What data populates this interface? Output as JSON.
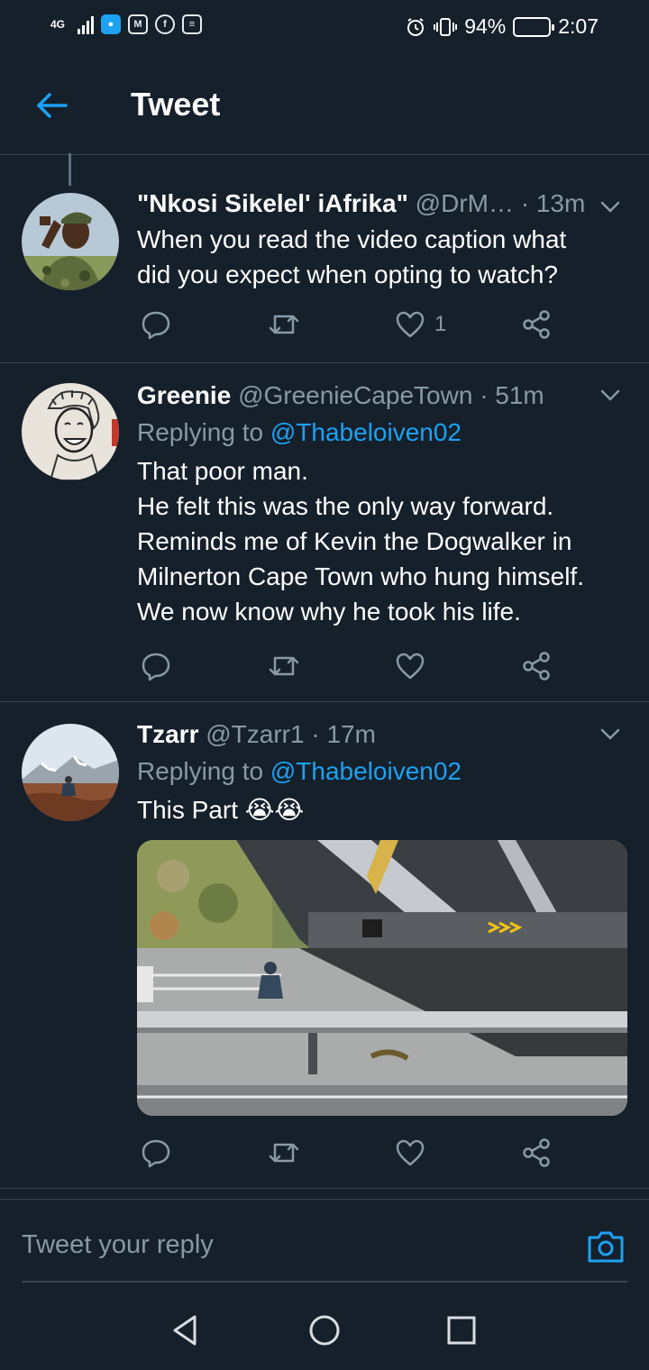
{
  "status_bar": {
    "network": "4G",
    "battery": "94%",
    "battery_level": 0.94,
    "time": "2:07",
    "app_icons": [
      "shield-app-icon",
      "gmail-icon",
      "facebook-icon",
      "news-icon"
    ]
  },
  "header": {
    "title": "Tweet"
  },
  "tweets": [
    {
      "name": "\"Nkosi Sikelel' iAfrika\"",
      "handle": "@DrM…",
      "time": "· 13m",
      "replying_label": "",
      "replying_to": "",
      "lines": [
        "When you read the video caption what",
        "did you expect when opting to watch?"
      ],
      "like_count": "1"
    },
    {
      "name": "Greenie",
      "handle": "@GreenieCapeTown",
      "time": "· 51m",
      "replying_label": "Replying to",
      "replying_to": "@Thabeloiven02",
      "lines": [
        "That poor man.",
        "He felt this was the only way forward.",
        "Reminds me of Kevin the Dogwalker in",
        "Milnerton Cape Town who hung himself.",
        "We now know why he took his life."
      ],
      "like_count": ""
    },
    {
      "name": "Tzarr",
      "handle": "@Tzarr1",
      "time": "· 17m",
      "replying_label": "Replying to",
      "replying_to": "@Thabeloiven02",
      "lines": [
        "This Part 😭😭"
      ],
      "like_count": ""
    }
  ],
  "reply_bar": {
    "placeholder": "Tweet your reply"
  },
  "colors": {
    "background": "#15202b",
    "accent": "#1da1f2",
    "secondary_text": "#8899a6",
    "divider": "#38444d"
  }
}
